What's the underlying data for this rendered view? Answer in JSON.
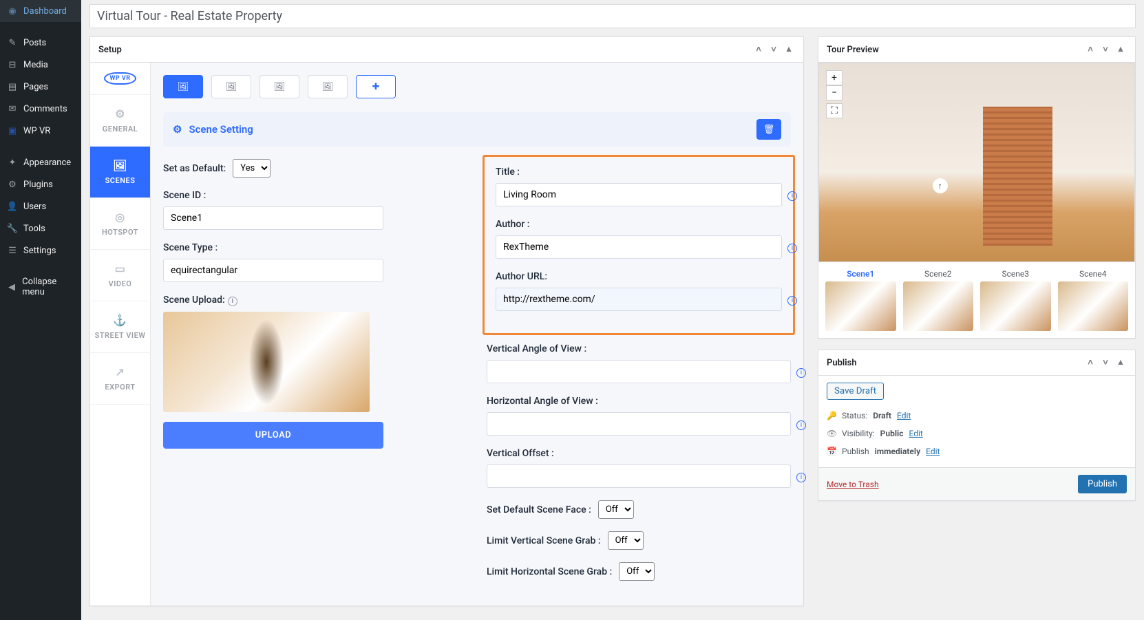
{
  "admin_menu": {
    "items": [
      {
        "label": "Dashboard",
        "icon": "◉"
      },
      {
        "label": "Posts",
        "icon": "✎"
      },
      {
        "label": "Media",
        "icon": "⊞"
      },
      {
        "label": "Pages",
        "icon": "▤"
      },
      {
        "label": "Comments",
        "icon": "✉"
      },
      {
        "label": "WP VR",
        "icon": "▣"
      },
      {
        "label": "Appearance",
        "icon": "✦"
      },
      {
        "label": "Plugins",
        "icon": "⚙"
      },
      {
        "label": "Users",
        "icon": "👤"
      },
      {
        "label": "Tools",
        "icon": "🔧"
      },
      {
        "label": "Settings",
        "icon": "☰"
      }
    ],
    "collapse": "Collapse menu"
  },
  "page_title": "Virtual Tour - Real Estate Property",
  "setup": {
    "header": "Setup",
    "vtabs": {
      "logo": "WP VR",
      "general": "GENERAL",
      "scenes": "SCENES",
      "hotspot": "HOTSPOT",
      "video": "VIDEO",
      "street": "STREET VIEW",
      "export": "EXPORT"
    },
    "scene_setting": "Scene Setting",
    "left": {
      "set_default_label": "Set as Default:",
      "set_default_value": "Yes",
      "scene_id_label": "Scene ID :",
      "scene_id_value": "Scene1",
      "scene_type_label": "Scene Type :",
      "scene_type_value": "equirectangular",
      "scene_upload_label": "Scene Upload:",
      "upload_btn": "UPLOAD"
    },
    "right": {
      "title_label": "Title :",
      "title_value": "Living Room",
      "author_label": "Author :",
      "author_value": "RexTheme",
      "author_url_label": "Author URL:",
      "author_url_value": "http://rextheme.com/",
      "vert_angle_label": "Vertical Angle of View :",
      "horiz_angle_label": "Horizontal Angle of View :",
      "vert_offset_label": "Vertical Offset :",
      "def_scene_face_label": "Set Default Scene Face :",
      "def_scene_face_value": "Off",
      "limit_vert_label": "Limit Vertical Scene Grab :",
      "limit_vert_value": "Off",
      "limit_horiz_label": "Limit Horizontal Scene Grab :",
      "limit_horiz_value": "Off"
    }
  },
  "tour_preview": {
    "header": "Tour Preview",
    "plus": "+",
    "minus": "−",
    "fullscreen": "⛶",
    "arrow": "↑",
    "scenes": [
      "Scene1",
      "Scene2",
      "Scene3",
      "Scene4"
    ]
  },
  "publish": {
    "header": "Publish",
    "save_draft": "Save Draft",
    "status_label": "Status:",
    "status_value": "Draft",
    "status_edit": "Edit",
    "visibility_label": "Visibility:",
    "visibility_value": "Public",
    "visibility_edit": "Edit",
    "publish_label": "Publish",
    "publish_value": "immediately",
    "publish_edit": "Edit",
    "trash": "Move to Trash",
    "publish_btn": "Publish"
  }
}
